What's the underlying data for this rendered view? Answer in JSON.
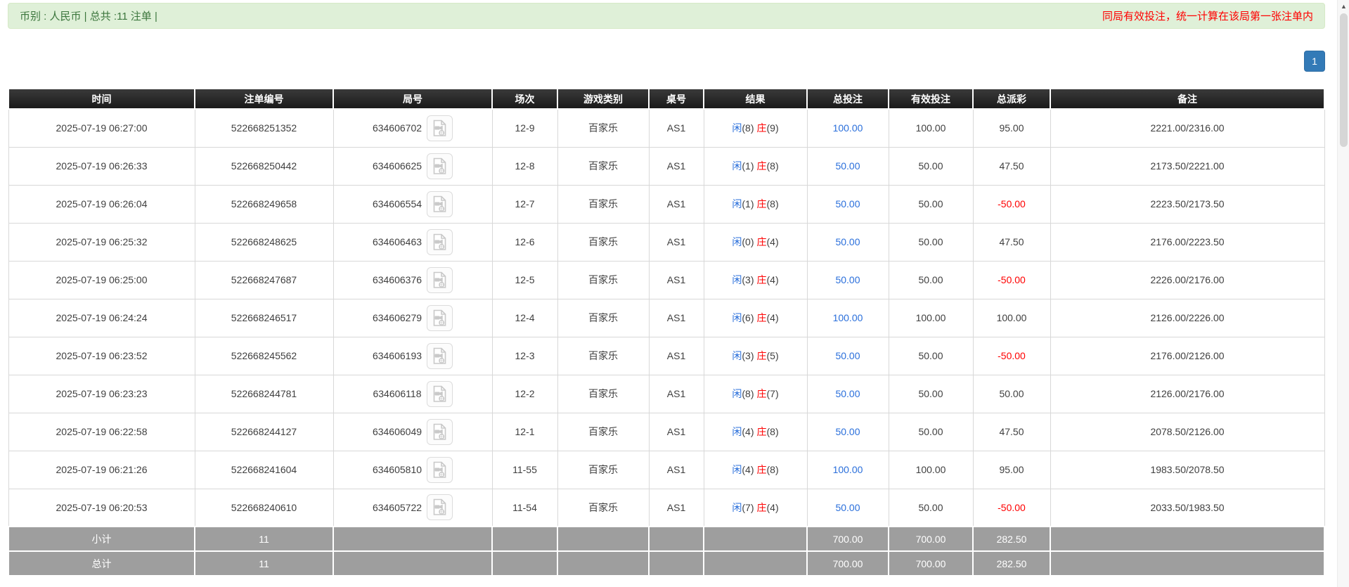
{
  "top_bar": {
    "summary": "币别 : 人民币 | 总共 :11 注单 |",
    "notice": "同局有效投注，统一计算在该局第一张注单内"
  },
  "pagination": {
    "current_page": "1"
  },
  "icons": {
    "scroll_up_glyph": "▲",
    "round_video_icon": "video-file-icon"
  },
  "colors": {
    "bar_green_bg": "#dff0d8",
    "bar_green_text": "#3c763d",
    "notice_red": "#ff0000",
    "header_black": "#1a1a1a",
    "footer_gray": "#9e9e9e",
    "amount_blue": "#2a6fdb",
    "loss_red": "#ff0000",
    "page_btn_blue": "#337ab7"
  },
  "table": {
    "columns": [
      "时间",
      "注单编号",
      "局号",
      "场次",
      "游戏类别",
      "桌号",
      "结果",
      "总投注",
      "有效投注",
      "总派彩",
      "备注"
    ],
    "rows": [
      {
        "time": "2025-07-19 06:27:00",
        "bet_id": "522668251352",
        "round_id": "634606702",
        "session": "12-9",
        "game_type": "百家乐",
        "table_no": "AS1",
        "player": "闲",
        "player_score": "(8)",
        "banker": "庄",
        "banker_score": "(9)",
        "total_bet": "100.00",
        "valid_bet": "100.00",
        "payout": "95.00",
        "remark": "2221.00/2316.00"
      },
      {
        "time": "2025-07-19 06:26:33",
        "bet_id": "522668250442",
        "round_id": "634606625",
        "session": "12-8",
        "game_type": "百家乐",
        "table_no": "AS1",
        "player": "闲",
        "player_score": "(1)",
        "banker": "庄",
        "banker_score": "(8)",
        "total_bet": "50.00",
        "valid_bet": "50.00",
        "payout": "47.50",
        "remark": "2173.50/2221.00"
      },
      {
        "time": "2025-07-19 06:26:04",
        "bet_id": "522668249658",
        "round_id": "634606554",
        "session": "12-7",
        "game_type": "百家乐",
        "table_no": "AS1",
        "player": "闲",
        "player_score": "(1)",
        "banker": "庄",
        "banker_score": "(8)",
        "total_bet": "50.00",
        "valid_bet": "50.00",
        "payout": "-50.00",
        "remark": "2223.50/2173.50"
      },
      {
        "time": "2025-07-19 06:25:32",
        "bet_id": "522668248625",
        "round_id": "634606463",
        "session": "12-6",
        "game_type": "百家乐",
        "table_no": "AS1",
        "player": "闲",
        "player_score": "(0)",
        "banker": "庄",
        "banker_score": "(4)",
        "total_bet": "50.00",
        "valid_bet": "50.00",
        "payout": "47.50",
        "remark": "2176.00/2223.50"
      },
      {
        "time": "2025-07-19 06:25:00",
        "bet_id": "522668247687",
        "round_id": "634606376",
        "session": "12-5",
        "game_type": "百家乐",
        "table_no": "AS1",
        "player": "闲",
        "player_score": "(3)",
        "banker": "庄",
        "banker_score": "(4)",
        "total_bet": "50.00",
        "valid_bet": "50.00",
        "payout": "-50.00",
        "remark": "2226.00/2176.00"
      },
      {
        "time": "2025-07-19 06:24:24",
        "bet_id": "522668246517",
        "round_id": "634606279",
        "session": "12-4",
        "game_type": "百家乐",
        "table_no": "AS1",
        "player": "闲",
        "player_score": "(6)",
        "banker": "庄",
        "banker_score": "(4)",
        "total_bet": "100.00",
        "valid_bet": "100.00",
        "payout": "100.00",
        "remark": "2126.00/2226.00"
      },
      {
        "time": "2025-07-19 06:23:52",
        "bet_id": "522668245562",
        "round_id": "634606193",
        "session": "12-3",
        "game_type": "百家乐",
        "table_no": "AS1",
        "player": "闲",
        "player_score": "(3)",
        "banker": "庄",
        "banker_score": "(5)",
        "total_bet": "50.00",
        "valid_bet": "50.00",
        "payout": "-50.00",
        "remark": "2176.00/2126.00"
      },
      {
        "time": "2025-07-19 06:23:23",
        "bet_id": "522668244781",
        "round_id": "634606118",
        "session": "12-2",
        "game_type": "百家乐",
        "table_no": "AS1",
        "player": "闲",
        "player_score": "(8)",
        "banker": "庄",
        "banker_score": "(7)",
        "total_bet": "50.00",
        "valid_bet": "50.00",
        "payout": "50.00",
        "remark": "2126.00/2176.00"
      },
      {
        "time": "2025-07-19 06:22:58",
        "bet_id": "522668244127",
        "round_id": "634606049",
        "session": "12-1",
        "game_type": "百家乐",
        "table_no": "AS1",
        "player": "闲",
        "player_score": "(4)",
        "banker": "庄",
        "banker_score": "(8)",
        "total_bet": "50.00",
        "valid_bet": "50.00",
        "payout": "47.50",
        "remark": "2078.50/2126.00"
      },
      {
        "time": "2025-07-19 06:21:26",
        "bet_id": "522668241604",
        "round_id": "634605810",
        "session": "11-55",
        "game_type": "百家乐",
        "table_no": "AS1",
        "player": "闲",
        "player_score": "(4)",
        "banker": "庄",
        "banker_score": "(8)",
        "total_bet": "100.00",
        "valid_bet": "100.00",
        "payout": "95.00",
        "remark": "1983.50/2078.50"
      },
      {
        "time": "2025-07-19 06:20:53",
        "bet_id": "522668240610",
        "round_id": "634605722",
        "session": "11-54",
        "game_type": "百家乐",
        "table_no": "AS1",
        "player": "闲",
        "player_score": "(7)",
        "banker": "庄",
        "banker_score": "(4)",
        "total_bet": "50.00",
        "valid_bet": "50.00",
        "payout": "-50.00",
        "remark": "2033.50/1983.50"
      }
    ],
    "subtotal": {
      "label": "小计",
      "count": "11",
      "total_bet": "700.00",
      "valid_bet": "700.00",
      "payout": "282.50"
    },
    "total": {
      "label": "总计",
      "count": "11",
      "total_bet": "700.00",
      "valid_bet": "700.00",
      "payout": "282.50"
    }
  }
}
